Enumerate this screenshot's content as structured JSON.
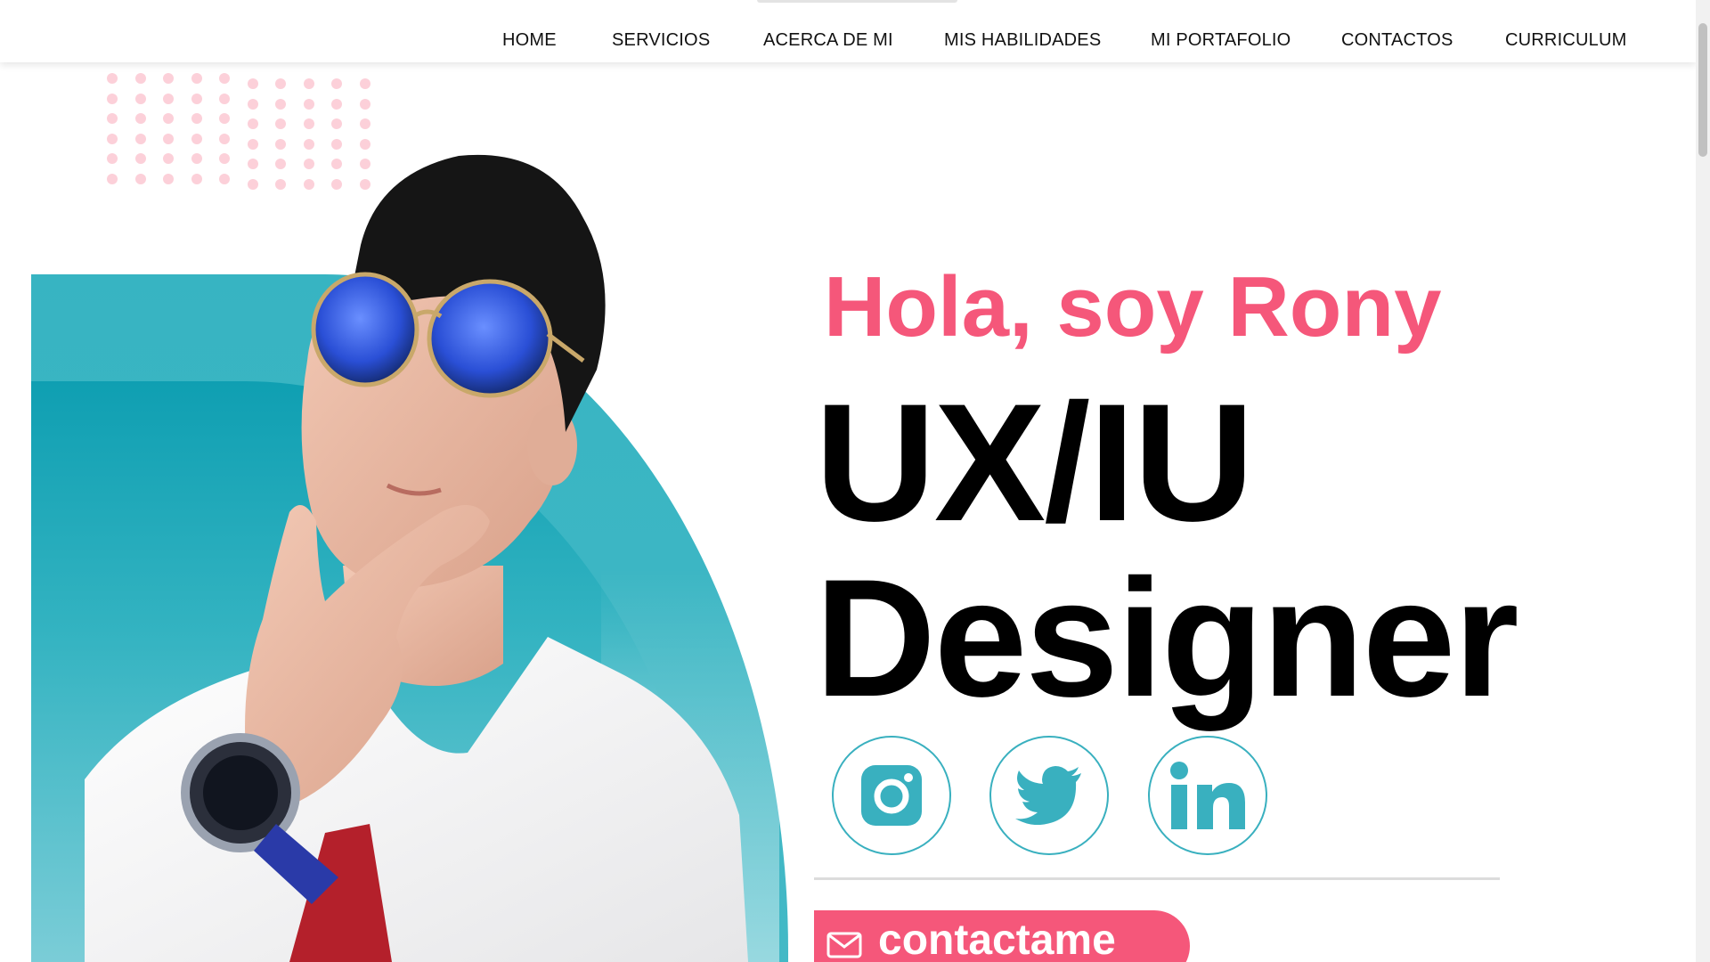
{
  "nav": {
    "items": [
      {
        "label": "HOME"
      },
      {
        "label": "SERVICIOS"
      },
      {
        "label": "ACERCA DE MI"
      },
      {
        "label": "MIS HABILIDADES"
      },
      {
        "label": "MI PORTAFOLIO"
      },
      {
        "label": "CONTACTOS"
      },
      {
        "label": "CURRICULUM"
      }
    ]
  },
  "hero": {
    "greeting": "Hola, soy Rony",
    "role_line1": "UX/IU",
    "role_line2": "Designer",
    "contact_label": "contactame"
  },
  "social": [
    {
      "icon": "instagram-icon"
    },
    {
      "icon": "twitter-icon"
    },
    {
      "icon": "linkedin-icon"
    }
  ],
  "colors": {
    "accent_pink": "#f5577a",
    "accent_teal": "#39b0bf",
    "dot_pink": "#fcd0d9"
  }
}
